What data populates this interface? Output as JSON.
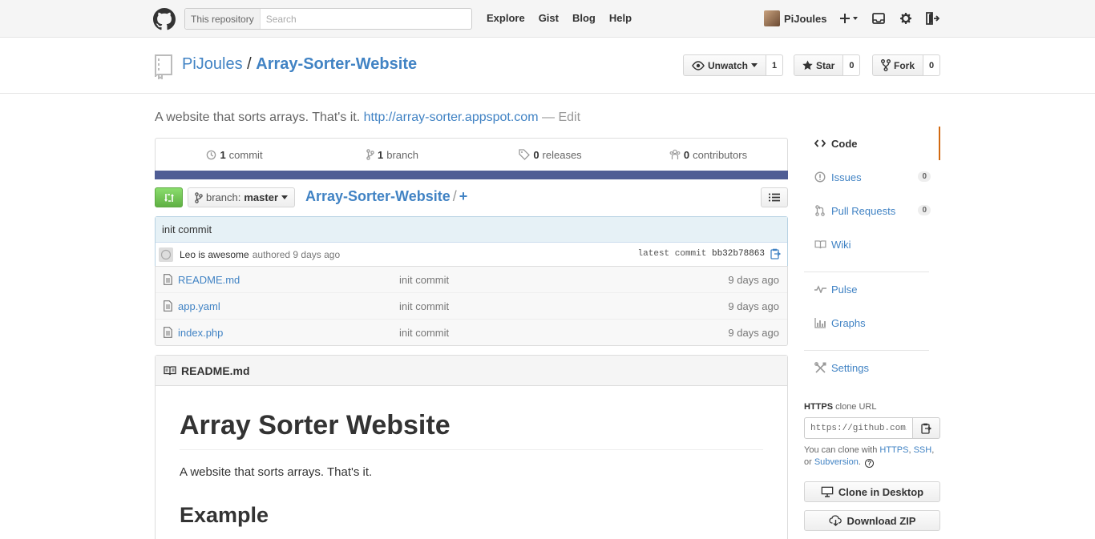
{
  "header": {
    "search_scope": "This repository",
    "search_placeholder": "Search",
    "nav": [
      "Explore",
      "Gist",
      "Blog",
      "Help"
    ],
    "username": "PiJoules",
    "icons": [
      "github-logo-icon",
      "plus-icon",
      "inbox-icon",
      "gear-icon",
      "sign-out-icon"
    ]
  },
  "repo": {
    "owner": "PiJoules",
    "separator": "/",
    "name": "Array-Sorter-Website",
    "actions": {
      "unwatch_label": "Unwatch",
      "unwatch_count": "1",
      "star_label": "Star",
      "star_count": "0",
      "fork_label": "Fork",
      "fork_count": "0"
    }
  },
  "description": {
    "text": "A website that sorts arrays. That's it.",
    "url": "http://array-sorter.appspot.com",
    "dash": "—",
    "edit": "Edit"
  },
  "summary": {
    "commits_num": "1",
    "commits_label": "commit",
    "branches_num": "1",
    "branches_label": "branch",
    "releases_num": "0",
    "releases_label": "releases",
    "contributors_num": "0",
    "contributors_label": "contributors",
    "language_color": "#4f5d95"
  },
  "file_nav": {
    "branch_prefix": "branch:",
    "branch_name": "master",
    "root": "Array-Sorter-Website",
    "sep": "/",
    "plus": "+"
  },
  "commit": {
    "title": "init commit",
    "author": "Leo is awesome",
    "authored": "authored 9 days ago",
    "latest_label": "latest commit",
    "sha": "bb32b78863"
  },
  "files": [
    {
      "name": "README.md",
      "message": "init commit",
      "age": "9 days ago"
    },
    {
      "name": "app.yaml",
      "message": "init commit",
      "age": "9 days ago"
    },
    {
      "name": "index.php",
      "message": "init commit",
      "age": "9 days ago"
    }
  ],
  "readme": {
    "filename": "README.md",
    "h1": "Array Sorter Website",
    "paragraph": "A website that sorts arrays. That's it.",
    "h2": "Example"
  },
  "sidebar": {
    "items": [
      {
        "label": "Code",
        "icon": "code-icon"
      },
      {
        "label": "Issues",
        "icon": "issue-icon",
        "count": "0"
      },
      {
        "label": "Pull Requests",
        "icon": "pull-request-icon",
        "count": "0"
      },
      {
        "label": "Wiki",
        "icon": "book-icon"
      },
      {
        "label": "Pulse",
        "icon": "pulse-icon"
      },
      {
        "label": "Graphs",
        "icon": "graph-icon"
      },
      {
        "label": "Settings",
        "icon": "tools-icon"
      }
    ],
    "active_color": "#d26911"
  },
  "clone": {
    "protocol": "HTTPS",
    "label": "clone URL",
    "url": "https://github.com/PiJoules/Array-Sorter-Website.git",
    "help_prefix": "You can clone with",
    "https": "HTTPS",
    "comma1": ",",
    "ssh": "SSH",
    "comma2": ",",
    "or": "or",
    "subversion": "Subversion",
    "period": ".",
    "help_icon": "?",
    "desktop_button": "Clone in Desktop",
    "zip_button": "Download ZIP"
  }
}
